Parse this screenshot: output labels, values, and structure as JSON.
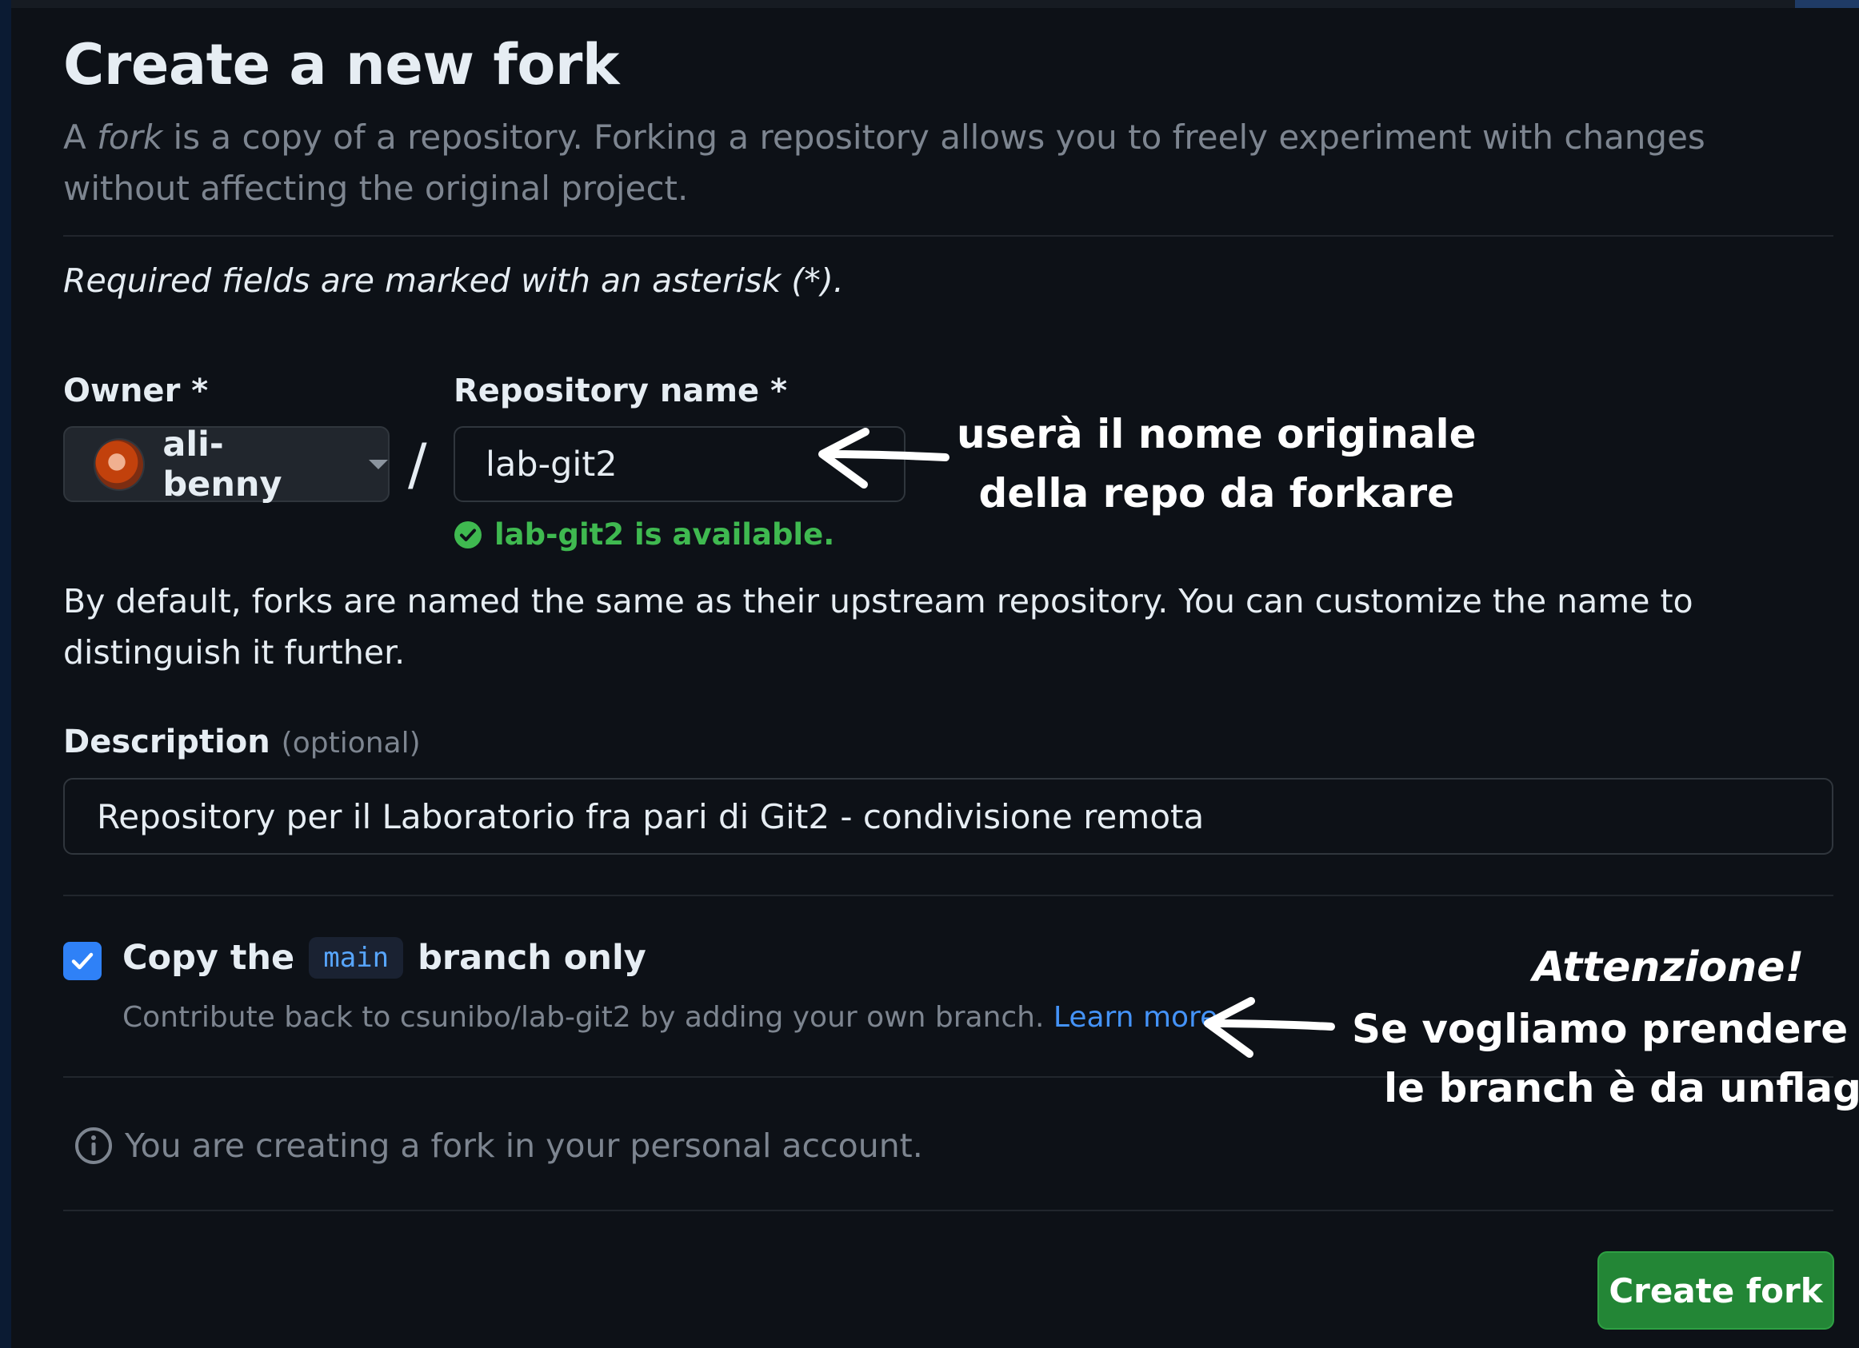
{
  "page": {
    "title": "Create a new fork",
    "subtitle_prefix": "A ",
    "subtitle_fork_word": "fork",
    "subtitle_rest": " is a copy of a repository. Forking a repository allows you to freely experiment with changes without affecting the original project.",
    "required_note": "Required fields are marked with an asterisk (*)."
  },
  "owner": {
    "label": "Owner *",
    "value": "ali-benny",
    "avatar_icon": "user-avatar"
  },
  "repo": {
    "label": "Repository name *",
    "value": "lab-git2",
    "availability": "lab-git2 is available.",
    "availability_color": "#3fb950"
  },
  "helper_text": "By default, forks are named the same as their upstream repository. You can customize the name to distinguish it further.",
  "description": {
    "label": "Description",
    "optional": "(optional)",
    "value": "Repository per il Laboratorio fra pari di Git2 - condivisione remota"
  },
  "copy_branch": {
    "checked": true,
    "prefix": "Copy the",
    "branch": "main",
    "suffix": "branch only",
    "help": "Contribute back to csunibo/lab-git2 by adding your own branch.",
    "learn_more": "Learn more."
  },
  "info_note": "You are creating a fork in your personal account.",
  "create_button": "Create fork",
  "annotations": {
    "note1_line1": "userà il nome originale",
    "note1_line2": "della repo da forkare",
    "note2_title": "Attenzione!",
    "note2_line1": "Se vogliamo prendere an",
    "note2_line2": "le branch è da unflagga"
  },
  "colors": {
    "background": "#0d1117",
    "accent_blue": "#2f81f7",
    "button_green": "#238636"
  }
}
